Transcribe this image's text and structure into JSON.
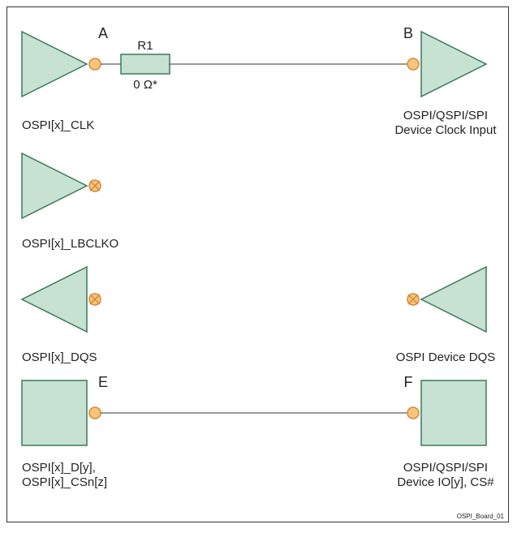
{
  "colors": {
    "fill": "#c7e1d2",
    "stroke": "#3a7a5a",
    "pin_fill": "#f8c57a",
    "pin_stroke": "#d6893a",
    "cross_stroke": "#d6893a",
    "wire": "#333333",
    "text": "#222222"
  },
  "nodes": {
    "A": "A",
    "B": "B",
    "E": "E",
    "F": "F"
  },
  "resistor": {
    "name": "R1",
    "value": "0 Ω*"
  },
  "labels": {
    "clk": "OSPI[x]_CLK",
    "lbclk": "OSPI[x]_LBCLKO",
    "dqs_left": "OSPI[x]_DQS",
    "dqs_right": "OSPI Device DQS",
    "data_left_l1": "OSPI[x]_D[y],",
    "data_left_l2": "OSPI[x]_CSn[z]",
    "device_clk_l1": "OSPI/QSPI/SPI",
    "device_clk_l2": "Device Clock Input",
    "device_io_l1": "OSPI/QSPI/SPI",
    "device_io_l2": "Device IO[y], CS#"
  },
  "footer": "OSPI_Board_01"
}
